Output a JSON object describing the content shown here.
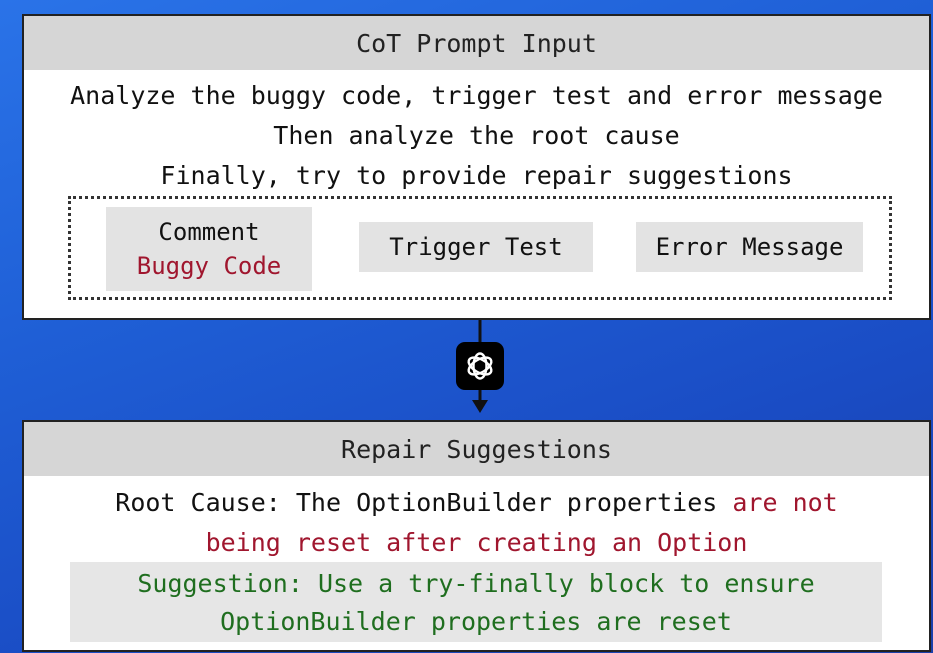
{
  "top_panel": {
    "title": "CoT Prompt Input",
    "line1": "Analyze the buggy code, trigger test and error message",
    "line2": "Then analyze the root cause",
    "line3": "Finally, try to provide repair suggestions",
    "chips": {
      "comment": "Comment",
      "buggy_code": "Buggy Code",
      "trigger_test": "Trigger Test",
      "error_message": "Error Message"
    }
  },
  "connector": {
    "icon": "openai-logo-icon"
  },
  "bottom_panel": {
    "title": "Repair Suggestions",
    "root_cause_prefix": "Root Cause: The OptionBuilder properties ",
    "root_cause_highlight_1": "are not",
    "root_cause_highlight_2": "being reset after creating an Option",
    "suggestion_line1": "Suggestion: Use a try-finally block to ensure",
    "suggestion_line2": "OptionBuilder properties are reset"
  },
  "colors": {
    "background": "#1f5fd6",
    "header_gray": "#d6d6d6",
    "red_text": "#a0162e",
    "green_text": "#1f6e1f"
  }
}
